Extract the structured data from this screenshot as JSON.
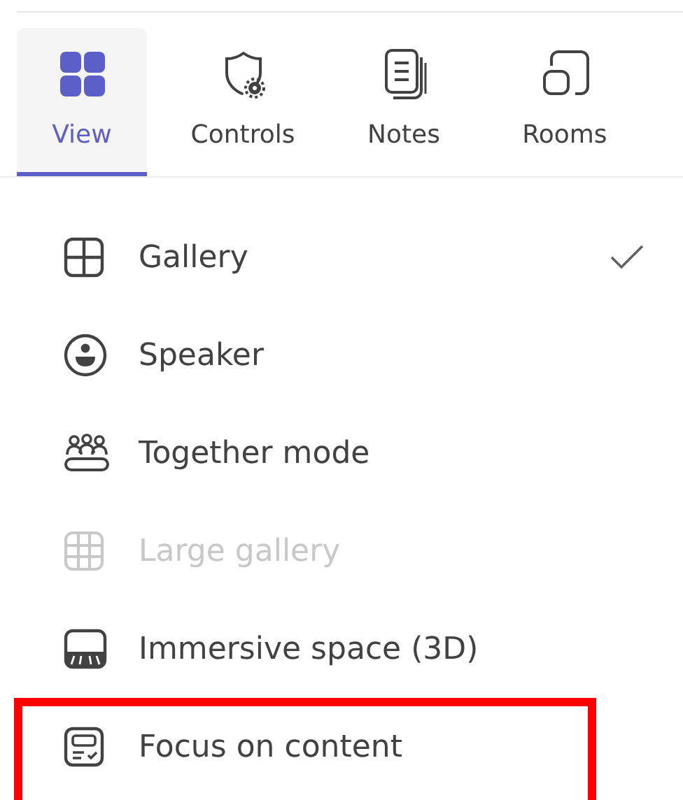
{
  "tabs": [
    {
      "label": "View",
      "selected": true
    },
    {
      "label": "Controls",
      "selected": false
    },
    {
      "label": "Notes",
      "selected": false
    },
    {
      "label": "Rooms",
      "selected": false
    }
  ],
  "menu": {
    "items": [
      {
        "label": "Gallery",
        "selected": true,
        "disabled": false,
        "highlighted": false
      },
      {
        "label": "Speaker",
        "selected": false,
        "disabled": false,
        "highlighted": false
      },
      {
        "label": "Together mode",
        "selected": false,
        "disabled": false,
        "highlighted": false
      },
      {
        "label": "Large gallery",
        "selected": false,
        "disabled": true,
        "highlighted": false
      },
      {
        "label": "Immersive space (3D)",
        "selected": false,
        "disabled": false,
        "highlighted": false
      },
      {
        "label": "Focus on content",
        "selected": false,
        "disabled": false,
        "highlighted": true
      }
    ]
  }
}
